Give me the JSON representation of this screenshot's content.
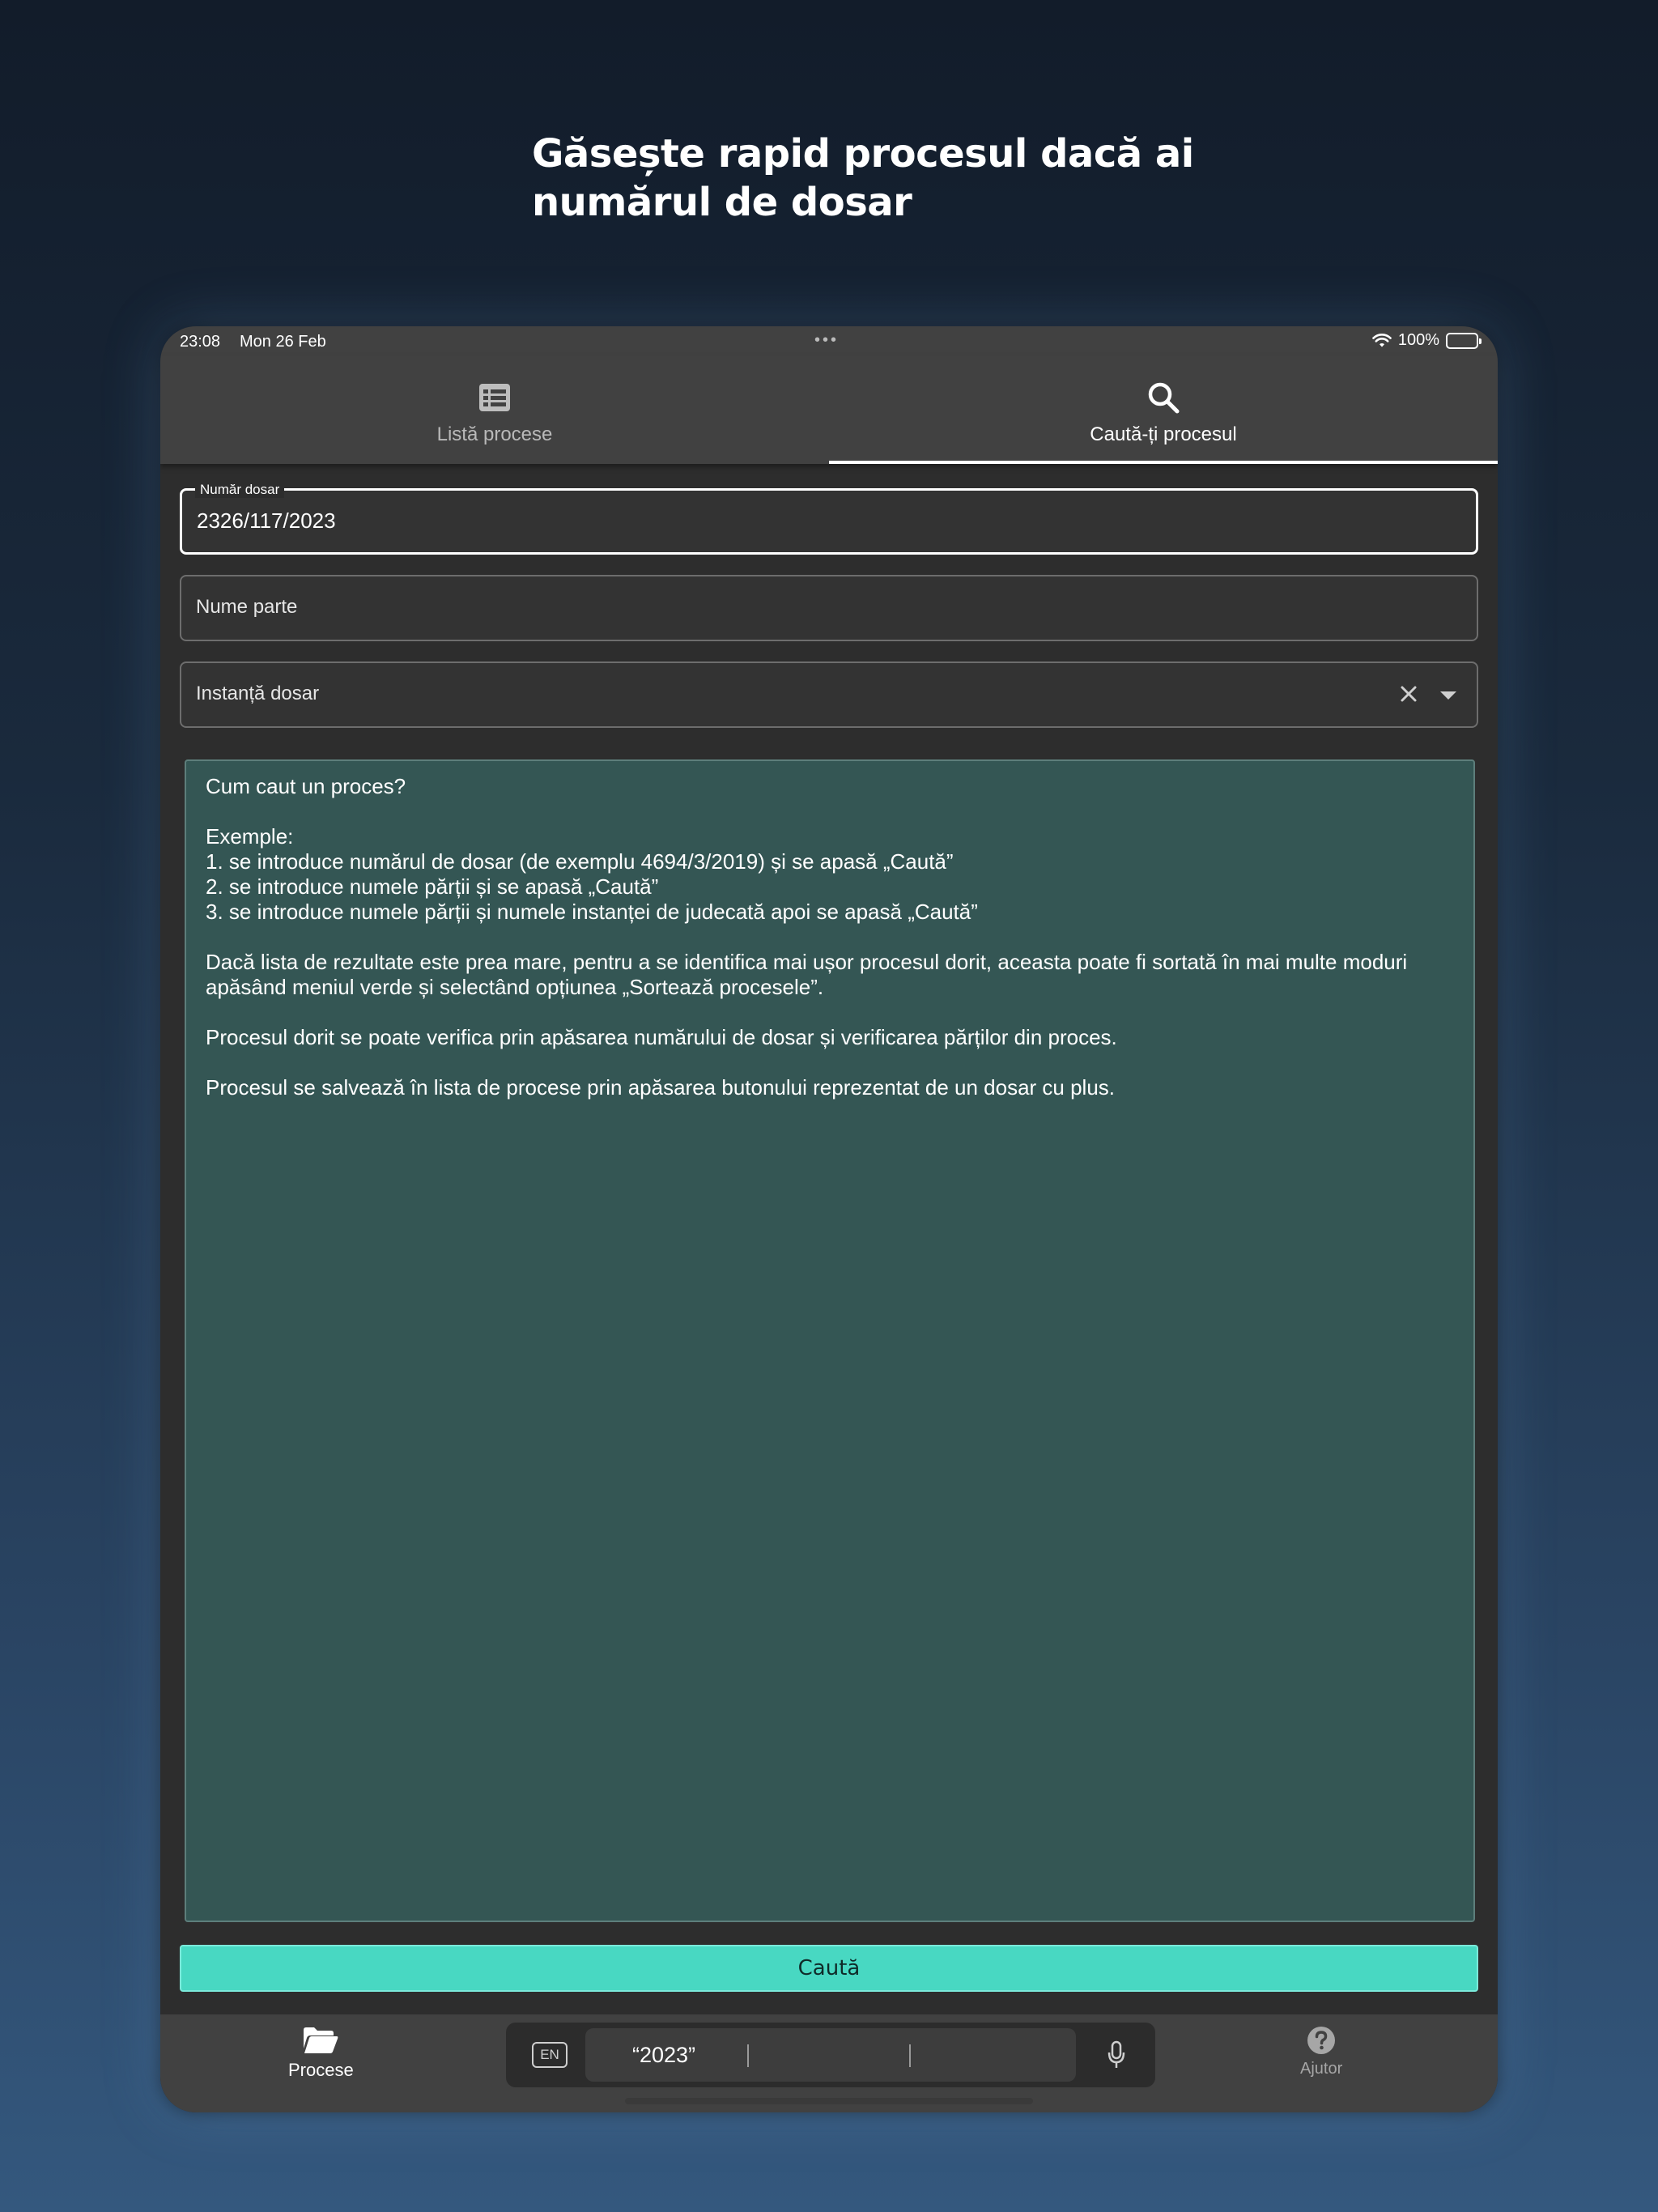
{
  "headline": {
    "line1": "Găsește rapid procesul dacă ai",
    "line2": "numărul de dosar"
  },
  "status_bar": {
    "time": "23:08",
    "date": "Mon 26 Feb",
    "battery": "100%",
    "icons": [
      "wifi-icon",
      "battery-icon"
    ]
  },
  "tabs": [
    {
      "label": "Listă procese",
      "icon": "list-icon",
      "active": false
    },
    {
      "label": "Caută-ți procesul",
      "icon": "search-icon",
      "active": true
    }
  ],
  "form": {
    "case_number": {
      "label": "Număr dosar",
      "value": "2326/117/2023"
    },
    "party_name": {
      "placeholder": "Nume parte"
    },
    "court": {
      "placeholder": "Instanță dosar",
      "icons": [
        "clear-icon",
        "dropdown-arrow-icon"
      ]
    }
  },
  "help": {
    "title": "Cum caut un proces?",
    "examples_heading": "Exemple:",
    "examples": [
      "1. se introduce numărul de dosar (de exemplu 4694/3/2019) și se apasă „Caută”",
      "2. se introduce numele părții și se apasă „Caută”",
      "3. se introduce numele părții și numele instanței de judecată apoi se apasă „Caută”"
    ],
    "paragraph_sort": "Dacă lista de rezultate este prea mare, pentru a se identifica mai ușor procesul dorit, aceasta poate fi sortată în mai multe moduri apăsând meniul verde și selectând opțiunea „Sortează procesele”.",
    "paragraph_verify": "Procesul dorit se poate verifica prin apăsarea numărului de dosar și verificarea părților din proces.",
    "paragraph_save": "Procesul se salvează în lista de procese prin apăsarea butonului reprezentat de un dosar cu plus."
  },
  "search_button": {
    "label": "Caută",
    "color": "#48d8c2"
  },
  "bottom_nav": {
    "procese": {
      "label": "Procese",
      "icon": "folder-open-icon"
    },
    "ajutor": {
      "label": "Ajutor",
      "icon": "help-circle-icon"
    }
  },
  "keyboard_bar": {
    "language": "EN",
    "suggestion": "“2023”",
    "icons": [
      "microphone-icon"
    ]
  }
}
